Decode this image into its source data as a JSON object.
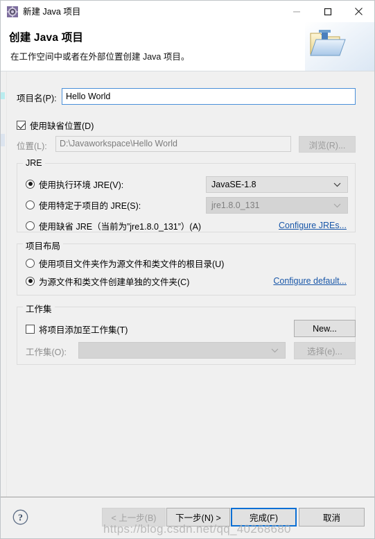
{
  "window": {
    "title": "新建 Java 项目",
    "icon": "java-project-gear-icon",
    "minimize_label": "—",
    "maximize_label": "□",
    "close_label": "✕"
  },
  "header": {
    "title": "创建 Java 项目",
    "description": "在工作空间中或者在外部位置创建 Java 项目。",
    "art_icon": "java-folder-icon"
  },
  "form": {
    "project_name": {
      "label": "项目名(P):",
      "value": "Hello World",
      "placeholder": ""
    },
    "use_default_location": {
      "label": "使用缺省位置(D)",
      "checked": true
    },
    "location": {
      "label": "位置(L):",
      "value": "D:\\Javaworkspace\\Hello World",
      "browse_label": "浏览(R)...",
      "disabled": true
    }
  },
  "jre_group": {
    "title": "JRE",
    "options": [
      {
        "label": "使用执行环境 JRE(V):",
        "selected": true
      },
      {
        "label": "使用特定于项目的 JRE(S):",
        "selected": false
      },
      {
        "label": "使用缺省 JRE（当前为”jre1.8.0_131”）(A)",
        "selected": false
      }
    ],
    "execution_env_value": "JavaSE-1.8",
    "project_jre_value": "jre1.8.0_131",
    "configure_link": "Configure JREs..."
  },
  "layout_group": {
    "title": "项目布局",
    "options": [
      {
        "label": "使用项目文件夹作为源文件和类文件的根目录(U)",
        "selected": false
      },
      {
        "label": "为源文件和类文件创建单独的文件夹(C)",
        "selected": true
      }
    ],
    "configure_link": "Configure default..."
  },
  "workingset_group": {
    "title": "工作集",
    "add_to_workingset": {
      "label": "将项目添加至工作集(T)",
      "checked": false
    },
    "new_button": "New...",
    "workingset_label": "工作集(O):",
    "workingset_value": "",
    "select_button": "选择(e)..."
  },
  "footer": {
    "help_icon": "help-question-icon",
    "buttons": [
      {
        "name": "back",
        "label": "< 上一步(B)",
        "state": "disabled"
      },
      {
        "name": "next",
        "label": "下一步(N) >",
        "state": "enabled"
      },
      {
        "name": "finish",
        "label": "完成(F)",
        "state": "default"
      },
      {
        "name": "cancel",
        "label": "取消",
        "state": "enabled"
      }
    ]
  },
  "watermark": "https://blog.csdn.net/qq_40268680",
  "colors": {
    "accent": "#0b6fd4",
    "link": "#1856a8",
    "dialog_bg": "#f0f0f0",
    "field_focus_border": "#4a90d9"
  }
}
